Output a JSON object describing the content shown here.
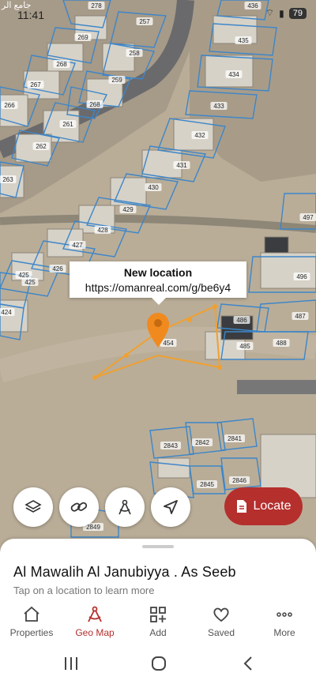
{
  "status_bar": {
    "time": "11:41",
    "arabic_label": "جامع الر",
    "battery": "79"
  },
  "map": {
    "parcel_labels": [
      "278",
      "257",
      "269",
      "258",
      "268",
      "259",
      "267",
      "268",
      "266",
      "261",
      "262",
      "263",
      "436",
      "435",
      "434",
      "433",
      "432",
      "431",
      "430",
      "429",
      "428",
      "427",
      "426",
      "425",
      "425",
      "424",
      "497",
      "496",
      "486",
      "487",
      "488",
      "485",
      "454",
      "2843",
      "2842",
      "2841",
      "2845",
      "2846",
      "2849"
    ],
    "popup": {
      "title": "New location",
      "url": "https://omanreal.com/g/be6y4"
    }
  },
  "controls": {
    "layers_icon": "layers-icon",
    "link_icon": "link-icon",
    "measure_icon": "compass-measure-icon",
    "navigate_icon": "navigation-arrow-icon",
    "locate_label": "Locate",
    "locate_color": "#b52f2d"
  },
  "sheet": {
    "title": "Al Mawalih Al Janubiyya . As Seeb",
    "subtitle": "Tap on a location to learn more"
  },
  "bottom_nav": {
    "items": [
      {
        "label": "Properties",
        "icon": "home-icon",
        "active": false
      },
      {
        "label": "Geo Map",
        "icon": "compass-icon",
        "active": true
      },
      {
        "label": "Add",
        "icon": "add-grid-icon",
        "active": false
      },
      {
        "label": "Saved",
        "icon": "heart-icon",
        "active": false
      },
      {
        "label": "More",
        "icon": "more-dots-icon",
        "active": false
      }
    ]
  },
  "system_nav": {
    "recents_icon": "recents-icon",
    "home_icon": "home-circle-icon",
    "back_icon": "back-icon"
  }
}
